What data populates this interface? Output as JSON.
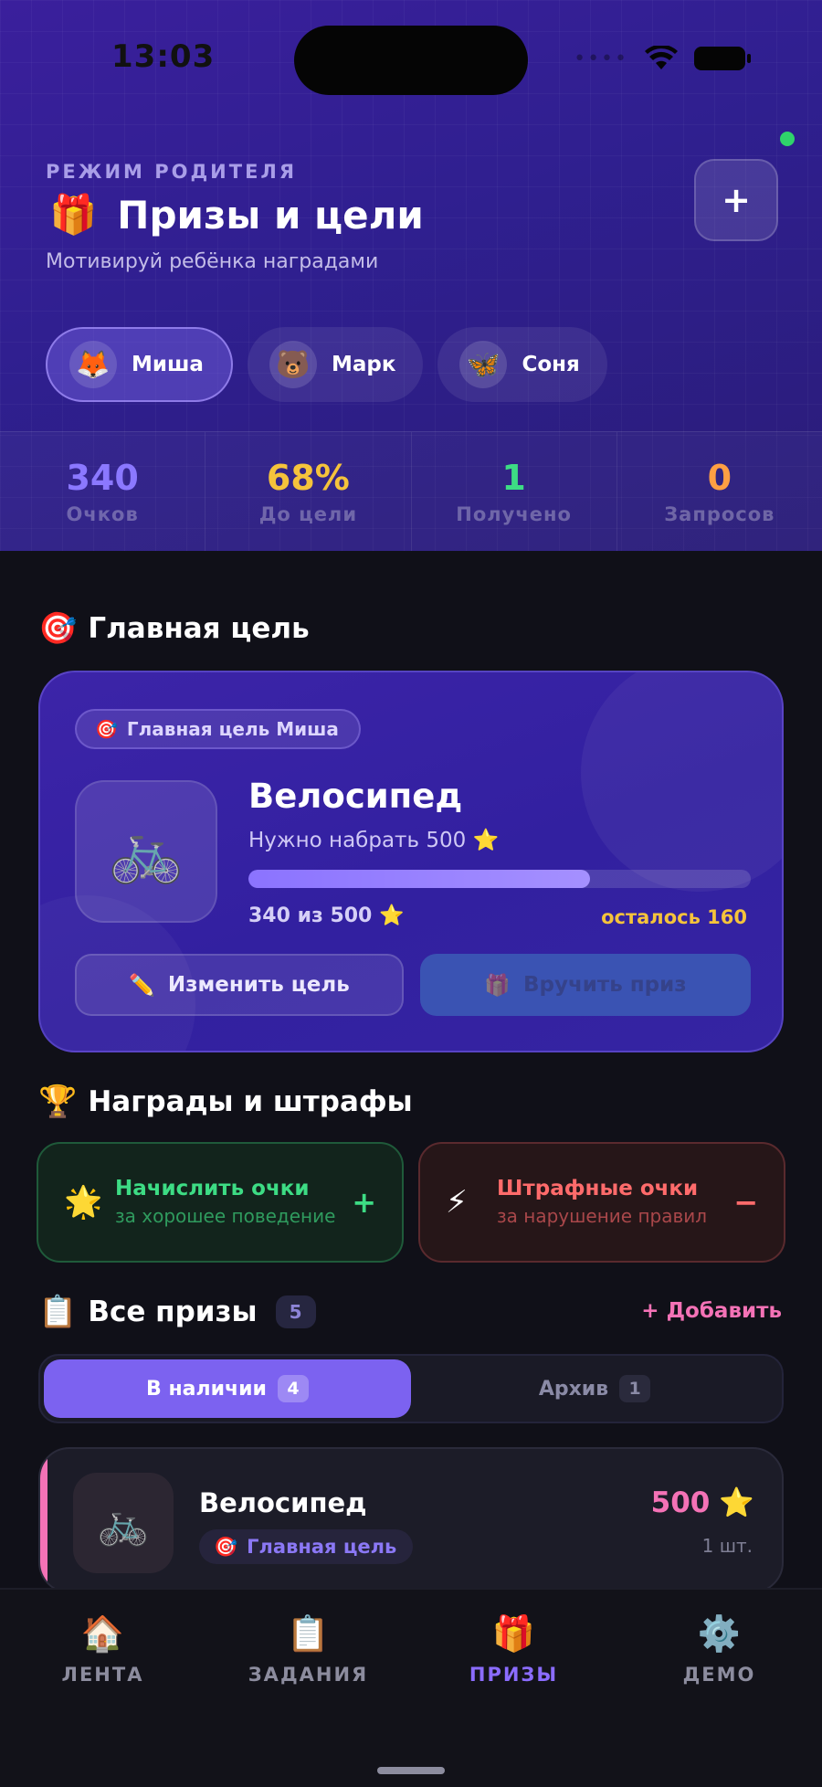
{
  "status": {
    "time": "13:03"
  },
  "header": {
    "mode_label": "РЕЖИМ РОДИТЕЛЯ",
    "title_emoji": "🎁",
    "title": "Призы и цели",
    "subtitle": "Мотивируй ребёнка наградами",
    "add_label": "+"
  },
  "kids": [
    {
      "emoji": "🦊",
      "name": "Миша",
      "active": true
    },
    {
      "emoji": "🐻",
      "name": "Марк",
      "active": false
    },
    {
      "emoji": "🦋",
      "name": "Соня",
      "active": false
    }
  ],
  "stats": [
    {
      "value": "340",
      "label": "Очков",
      "color": "#8b78ff"
    },
    {
      "value": "68%",
      "label": "До цели",
      "color": "#f5c33b"
    },
    {
      "value": "1",
      "label": "Получено",
      "color": "#3ddc84"
    },
    {
      "value": "0",
      "label": "Запросов",
      "color": "#ff9f43"
    }
  ],
  "main_goal": {
    "section_emoji": "🎯",
    "section_title": "Главная цель",
    "tag_emoji": "🎯",
    "tag": "Главная цель Миша",
    "image_emoji": "🚲",
    "name": "Велосипед",
    "need": "Нужно набрать 500 ⭐",
    "progress": 0.68,
    "count": "340 из 500 ⭐",
    "left": "осталось 160",
    "edit_emoji": "✏️",
    "edit_label": "Изменить цель",
    "give_emoji": "🎁",
    "give_label": "Вручить приз"
  },
  "rewards": {
    "section_emoji": "🏆",
    "section_title": "Награды и штрафы",
    "plus": {
      "emoji": "🌟",
      "title": "Начислить очки",
      "desc": "за хорошее поведение",
      "sign": "+"
    },
    "minus": {
      "emoji": "⚡",
      "title": "Штрафные очки",
      "desc": "за нарушение правил",
      "sign": "−"
    }
  },
  "prizes": {
    "section_emoji": "📋",
    "section_title": "Все призы",
    "count": "5",
    "add_label": "+ Добавить",
    "tabs": [
      {
        "label": "В наличии",
        "count": "4",
        "active": true
      },
      {
        "label": "Архив",
        "count": "1",
        "active": false
      }
    ],
    "items": [
      {
        "emoji": "🚲",
        "name": "Велосипед",
        "tag_emoji": "🎯",
        "tag": "Главная цель",
        "price": "500",
        "price_emoji": "⭐",
        "qty": "1 шт."
      }
    ]
  },
  "tabbar": [
    {
      "emoji": "🏠",
      "label": "ЛЕНТА",
      "active": false
    },
    {
      "emoji": "📋",
      "label": "ЗАДАНИЯ",
      "active": false
    },
    {
      "emoji": "🎁",
      "label": "ПРИЗЫ",
      "active": true
    },
    {
      "emoji": "⚙️",
      "label": "ДЕМО",
      "active": false
    }
  ]
}
